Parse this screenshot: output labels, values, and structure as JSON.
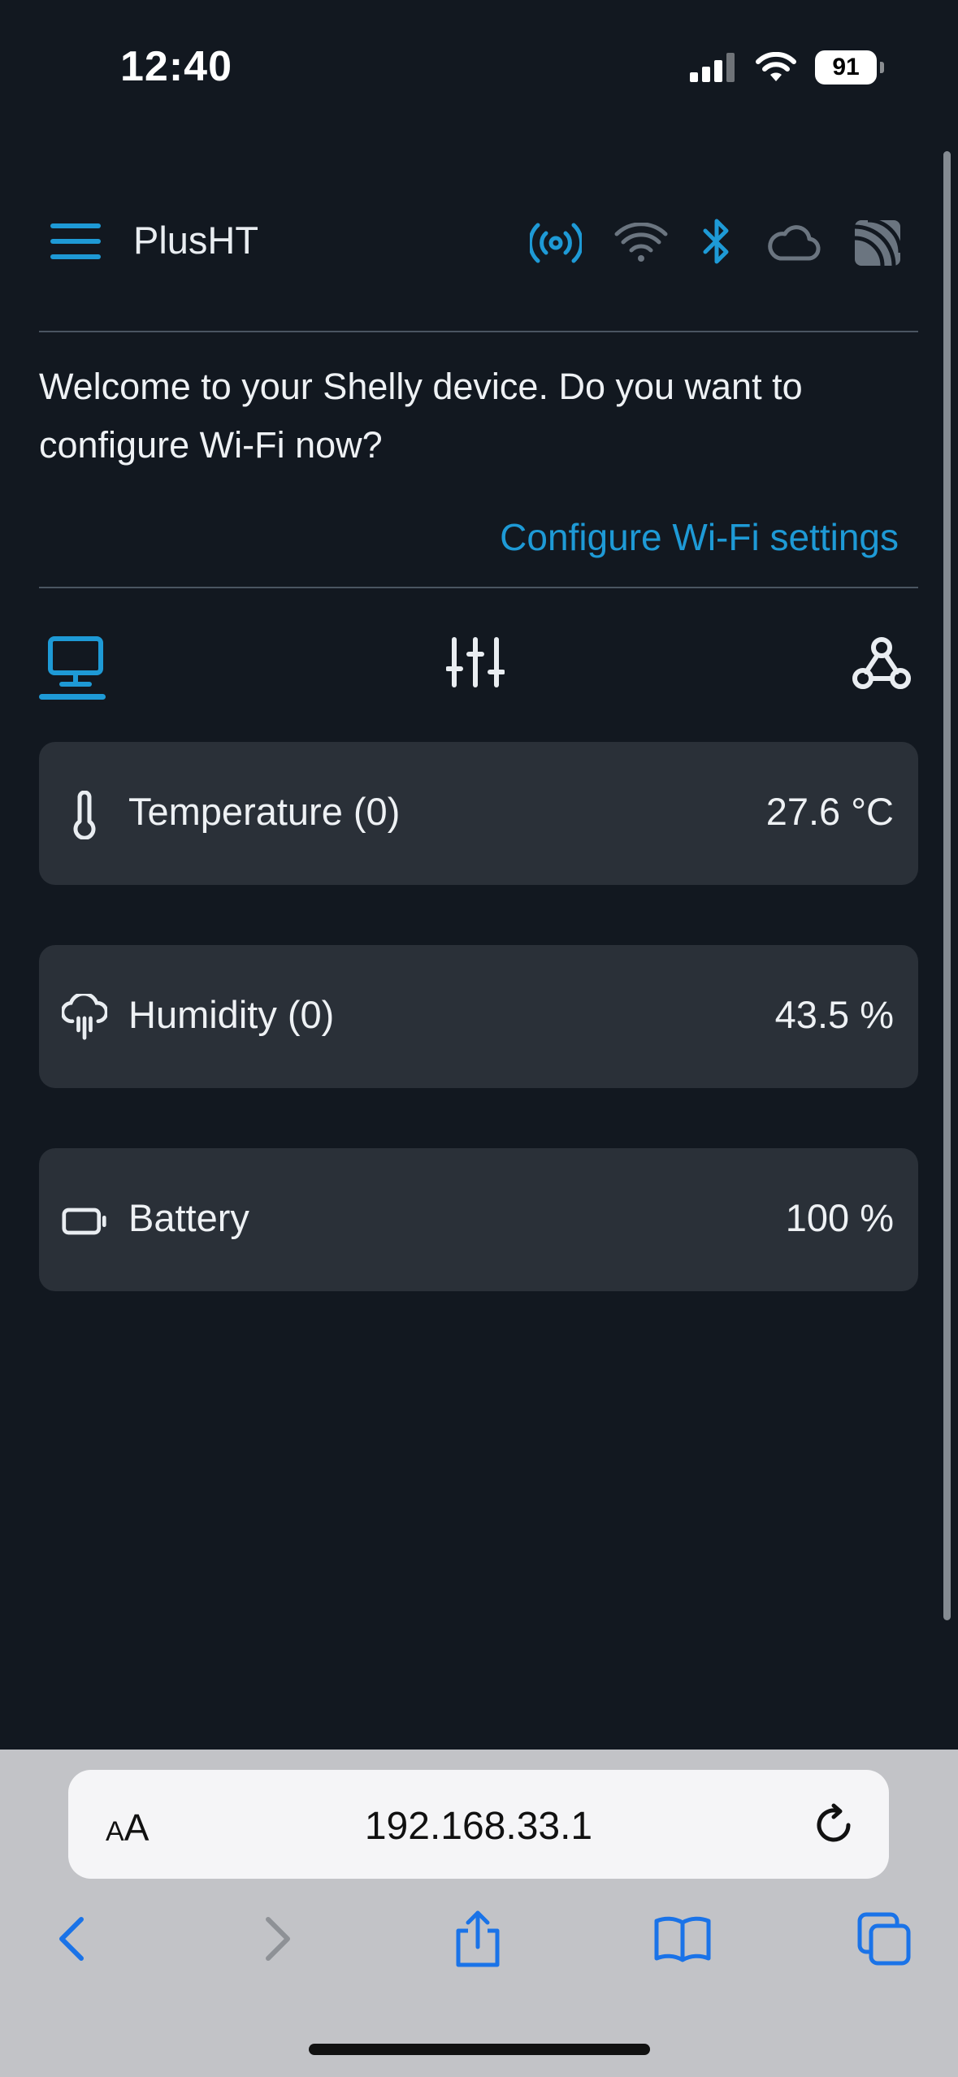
{
  "status_bar": {
    "time": "12:40",
    "battery": "91"
  },
  "header": {
    "title": "PlusHT",
    "icons": [
      "menu-icon",
      "radio-broadcast-icon",
      "wifi-icon",
      "bluetooth-icon",
      "cloud-icon",
      "mqtt-icon"
    ]
  },
  "welcome": {
    "message": "Welcome to your Shelly device. Do you want to configure Wi-Fi now?",
    "link": "Configure Wi-Fi settings"
  },
  "tabs": [
    "monitor-icon",
    "sliders-icon",
    "webhook-icon"
  ],
  "sensors": [
    {
      "label": "Temperature (0)",
      "value": "27.6 °C",
      "icon": "thermometer-icon"
    },
    {
      "label": "Humidity (0)",
      "value": "43.5 %",
      "icon": "humidity-icon"
    },
    {
      "label": "Battery",
      "value": "100 %",
      "icon": "battery-icon"
    }
  ],
  "browser": {
    "aa_small": "A",
    "aa_large": "A",
    "url": "192.168.33.1"
  },
  "colors": {
    "background": "#121820",
    "card": "#2a3038",
    "accent": "#1e9ad6",
    "muted_icon": "#6b7580"
  }
}
